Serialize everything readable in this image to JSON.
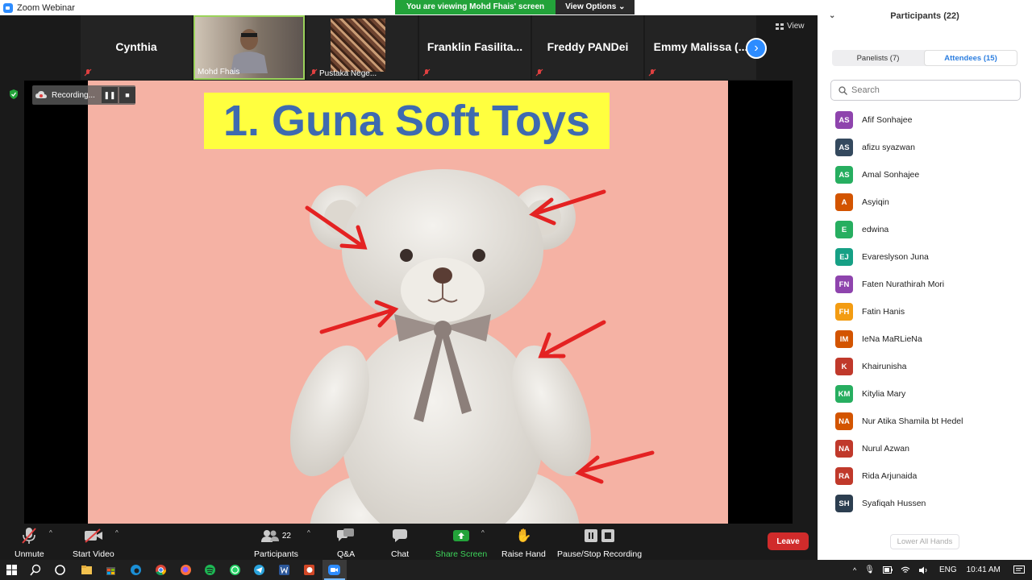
{
  "window": {
    "title": "Zoom Webinar",
    "banner_text": "You are viewing Mohd Fhais' screen",
    "view_options_label": "View Options"
  },
  "gallery": {
    "tiles": [
      {
        "name": "Cynthia"
      },
      {
        "name": "Mohd Fhais"
      },
      {
        "name": "Pustaka Nege..."
      },
      {
        "name": "Franklin Fasilita..."
      },
      {
        "name": "Freddy PANDei"
      },
      {
        "name": "Emmy Malissa (..."
      }
    ],
    "view_label": "View"
  },
  "recording": {
    "status_text": "Recording..."
  },
  "slide": {
    "title": "1. Guna Soft Toys"
  },
  "toolbar": {
    "unmute": "Unmute",
    "start_video": "Start Video",
    "participants": "Participants",
    "participants_count": "22",
    "qa": "Q&A",
    "chat": "Chat",
    "share_screen": "Share Screen",
    "raise_hand": "Raise Hand",
    "pause_stop_recording": "Pause/Stop Recording",
    "leave": "Leave",
    "share_color": "#23a33a",
    "leave_color": "#d02b2b"
  },
  "panel": {
    "title": "Participants (22)",
    "tabs": [
      {
        "label": "Panelists (7)",
        "active": false
      },
      {
        "label": "Attendees (15)",
        "active": true
      }
    ],
    "search_placeholder": "Search",
    "attendees": [
      {
        "initials": "AS",
        "name": "Afif Sonhajee",
        "color": "#8e44ad"
      },
      {
        "initials": "AS",
        "name": "afizu syazwan",
        "color": "#34495e"
      },
      {
        "initials": "AS",
        "name": "Amal Sonhajee",
        "color": "#27ae60"
      },
      {
        "initials": "A",
        "name": "Asyiqin",
        "color": "#d35400"
      },
      {
        "initials": "E",
        "name": "edwina",
        "color": "#27ae60"
      },
      {
        "initials": "EJ",
        "name": "Evareslyson Juna",
        "color": "#16a085"
      },
      {
        "initials": "FN",
        "name": "Faten Nurathirah Mori",
        "color": "#8e44ad"
      },
      {
        "initials": "FH",
        "name": "Fatin Hanis",
        "color": "#f39c12"
      },
      {
        "initials": "IM",
        "name": "IeNa MaRLieNa",
        "color": "#d35400"
      },
      {
        "initials": "K",
        "name": "Khairunisha",
        "color": "#c0392b"
      },
      {
        "initials": "KM",
        "name": "Kitylia Mary",
        "color": "#27ae60"
      },
      {
        "initials": "NA",
        "name": "Nur Atika Shamila bt Hedel",
        "color": "#d35400"
      },
      {
        "initials": "NA",
        "name": "Nurul Azwan",
        "color": "#c0392b"
      },
      {
        "initials": "RA",
        "name": "Rida Arjunaida",
        "color": "#c0392b"
      },
      {
        "initials": "SH",
        "name": "Syafiqah Hussen",
        "color": "#2c3e50"
      }
    ],
    "lower_all_hands": "Lower All Hands"
  },
  "taskbar": {
    "language": "ENG",
    "time": "10:41 AM"
  }
}
